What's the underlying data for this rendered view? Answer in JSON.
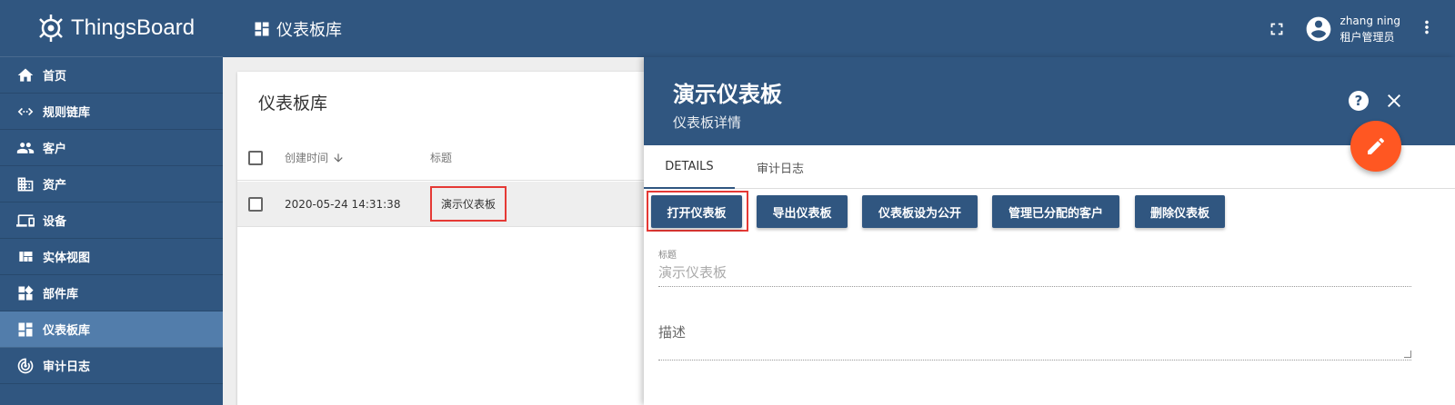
{
  "app": {
    "name": "ThingsBoard"
  },
  "sidebar": {
    "items": [
      {
        "label": "首页",
        "icon": "home-icon"
      },
      {
        "label": "规则链库",
        "icon": "code-arrows-icon"
      },
      {
        "label": "客户",
        "icon": "people-icon"
      },
      {
        "label": "资产",
        "icon": "domain-icon"
      },
      {
        "label": "设备",
        "icon": "devices-icon"
      },
      {
        "label": "实体视图",
        "icon": "view-quilt-icon"
      },
      {
        "label": "部件库",
        "icon": "widgets-icon"
      },
      {
        "label": "仪表板库",
        "icon": "dashboard-icon",
        "active": true
      },
      {
        "label": "审计日志",
        "icon": "track-changes-icon"
      }
    ]
  },
  "header": {
    "title": "仪表板库",
    "user_name": "zhang ning",
    "user_role": "租户管理员"
  },
  "main": {
    "title": "仪表板库",
    "columns": {
      "created": "创建时间",
      "title": "标题"
    },
    "rows": [
      {
        "created": "2020-05-24 14:31:38",
        "title": "演示仪表板"
      }
    ]
  },
  "details": {
    "title": "演示仪表板",
    "subtitle": "仪表板详情",
    "help": "?",
    "tabs": [
      "DETAILS",
      "审计日志"
    ],
    "buttons": [
      "打开仪表板",
      "导出仪表板",
      "仪表板设为公开",
      "管理已分配的客户",
      "删除仪表板"
    ],
    "field_title_label": "标题",
    "field_title_value": "演示仪表板",
    "field_desc_label": "描述"
  },
  "colors": {
    "primary": "#305680",
    "active_nav": "#527dab",
    "fab": "#ff5722",
    "highlight": "#e53935"
  }
}
